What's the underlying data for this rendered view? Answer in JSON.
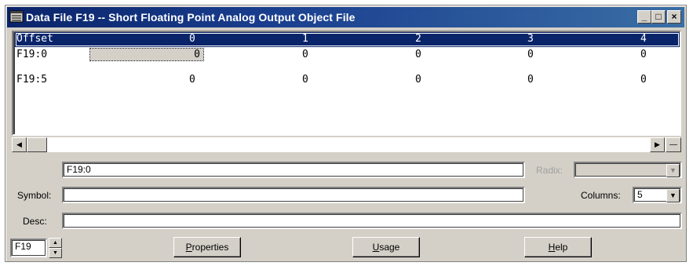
{
  "window": {
    "title": "Data File F19  --  Short Floating Point Analog Output Object File",
    "controls": {
      "minimize": "_",
      "maximize": "□",
      "close": "×"
    }
  },
  "grid": {
    "header": {
      "offset": "Offset",
      "columns": [
        "0",
        "1",
        "2",
        "3",
        "4"
      ]
    },
    "rows": [
      {
        "label": "F19:0",
        "values": [
          "0",
          "0",
          "0",
          "0",
          "0"
        ]
      },
      {
        "label": "F19:5",
        "values": [
          "0",
          "0",
          "0",
          "0",
          "0"
        ]
      }
    ],
    "selected_cell": "F19:0 / column 0"
  },
  "scrollbar": {
    "left_arrow": "◀",
    "right_arrow": "▶",
    "collapse": "—"
  },
  "address": {
    "value": "F19:0"
  },
  "radix": {
    "label": "Radix:",
    "value": "",
    "enabled": false
  },
  "symbol": {
    "label": "Symbol:",
    "value": ""
  },
  "columns": {
    "label": "Columns:",
    "value": "5"
  },
  "desc": {
    "label": "Desc:",
    "value": ""
  },
  "file_selector": {
    "value": "F19"
  },
  "buttons": {
    "properties": {
      "accel": "P",
      "rest": "roperties"
    },
    "usage": {
      "accel": "U",
      "rest": "sage"
    },
    "help": {
      "accel": "H",
      "rest": "elp"
    }
  },
  "colors": {
    "title_start": "#0a246a",
    "title_end": "#3a6ea5",
    "face": "#d4d0c8",
    "header_bg": "#0a246a"
  }
}
